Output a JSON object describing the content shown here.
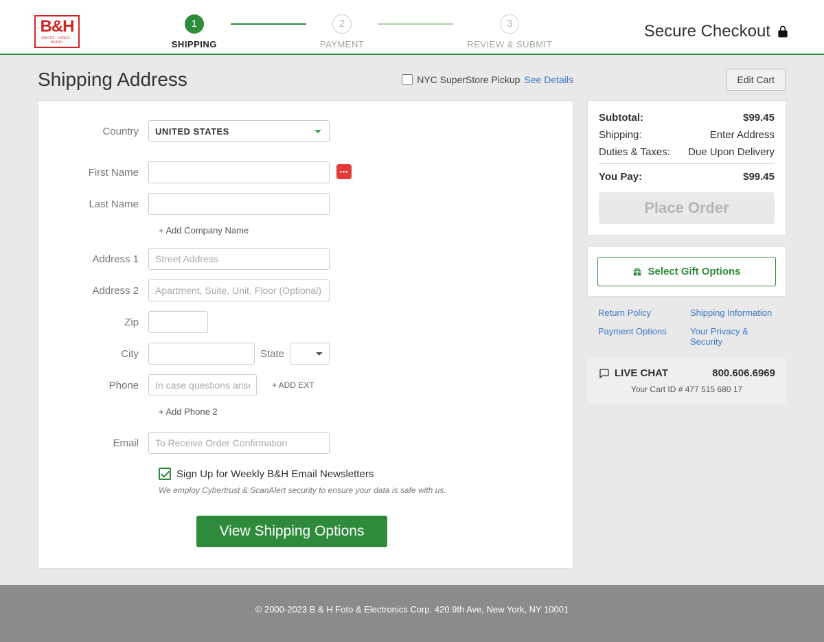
{
  "logo": {
    "main": "B&H",
    "tag": "PHOTO · VIDEO · AUDIO"
  },
  "steps": [
    {
      "num": "1",
      "label": "SHIPPING"
    },
    {
      "num": "2",
      "label": "PAYMENT"
    },
    {
      "num": "3",
      "label": "REVIEW & SUBMIT"
    }
  ],
  "secure_text": "Secure Checkout",
  "page_title": "Shipping Address",
  "pickup": {
    "label": "NYC SuperStore Pickup",
    "link": "See Details"
  },
  "form": {
    "country_label": "Country",
    "country_value": "UNITED STATES",
    "first_name_label": "First Name",
    "last_name_label": "Last Name",
    "add_company": "+ Add Company Name",
    "address1_label": "Address 1",
    "address1_placeholder": "Street Address",
    "address2_label": "Address 2",
    "address2_placeholder": "Apartment, Suite, Unit, Floor (Optional)",
    "zip_label": "Zip",
    "city_label": "City",
    "state_label": "State",
    "phone_label": "Phone",
    "phone_placeholder": "In case questions arise",
    "add_ext": "+ ADD EXT",
    "add_phone2": "+ Add Phone 2",
    "email_label": "Email",
    "email_placeholder": "To Receive Order Confirmation",
    "newsletter": "Sign Up for Weekly B&H Email Newsletters",
    "security_note": "We employ Cybertrust & ScanAlert security to ensure your data is safe with us.",
    "submit": "View Shipping Options",
    "validation_dots": "•••"
  },
  "edit_cart": "Edit Cart",
  "summary": {
    "subtotal_label": "Subtotal:",
    "subtotal_value": "$99.45",
    "shipping_label": "Shipping:",
    "shipping_value": "Enter Address",
    "duties_label": "Duties & Taxes:",
    "duties_value": "Due Upon Delivery",
    "youpay_label": "You Pay:",
    "youpay_value": "$99.45",
    "place_order": "Place Order"
  },
  "gift_button": "Select Gift Options",
  "help_links": {
    "return": "Return Policy",
    "shipping_info": "Shipping Information",
    "payment": "Payment Options",
    "privacy": "Your Privacy & Security"
  },
  "contact": {
    "live_chat": "LIVE CHAT",
    "phone": "800.606.6969",
    "cart_id": "Your Cart ID # 477 515 680 17"
  },
  "footer": "© 2000-2023 B & H Foto & Electronics Corp. 420 9th Ave, New York, NY 10001"
}
